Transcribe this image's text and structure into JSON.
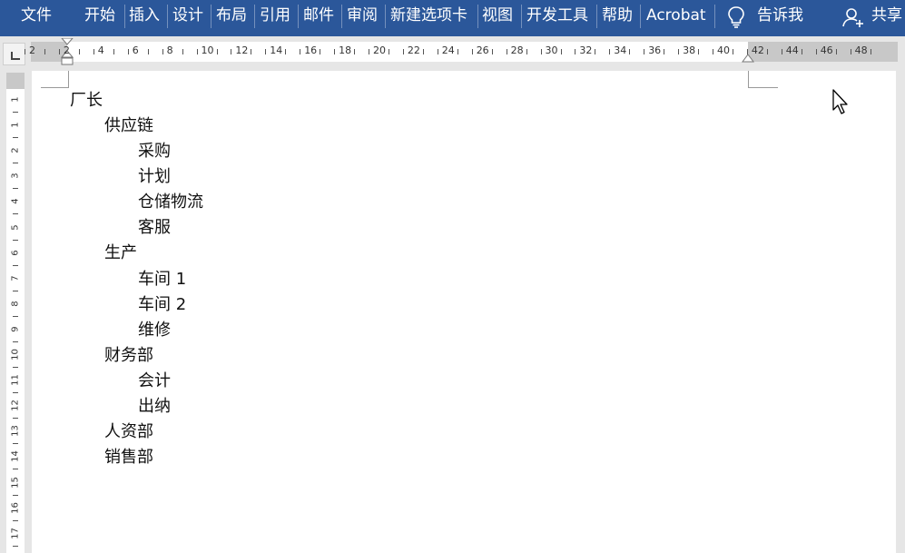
{
  "ribbon": {
    "tabs": [
      "文件",
      "开始",
      "插入",
      "设计",
      "布局",
      "引用",
      "邮件",
      "审阅",
      "新建选项卡",
      "视图",
      "开发工具",
      "帮助",
      "Acrobat"
    ],
    "tell_me": "告诉我",
    "share": "共享"
  },
  "ruler": {
    "h_labels": [
      "2",
      "2",
      "4",
      "6",
      "8",
      "10",
      "12",
      "14",
      "16",
      "18",
      "20",
      "22",
      "24",
      "26",
      "28",
      "30",
      "32",
      "34",
      "36",
      "38",
      "40",
      "42",
      "44",
      "46",
      "48"
    ],
    "v_labels": [
      "1",
      "1",
      "2",
      "3",
      "4",
      "5",
      "6",
      "7",
      "8",
      "9",
      "10",
      "11",
      "12",
      "13",
      "14",
      "15",
      "16",
      "17",
      "18"
    ]
  },
  "document": {
    "lines": [
      {
        "text": "厂长",
        "level": 0
      },
      {
        "text": "供应链",
        "level": 1
      },
      {
        "text": "采购",
        "level": 2
      },
      {
        "text": "计划",
        "level": 2
      },
      {
        "text": "仓储物流",
        "level": 2
      },
      {
        "text": "客服",
        "level": 2
      },
      {
        "text": "生产",
        "level": 1
      },
      {
        "text": "车间 1",
        "level": 2
      },
      {
        "text": "车间 2",
        "level": 2
      },
      {
        "text": "维修",
        "level": 2
      },
      {
        "text": "财务部",
        "level": 1
      },
      {
        "text": "会计",
        "level": 2
      },
      {
        "text": "出纳",
        "level": 2
      },
      {
        "text": "人资部",
        "level": 1
      },
      {
        "text": "销售部",
        "level": 1
      }
    ]
  },
  "colors": {
    "ribbon": "#2b579a",
    "workspace": "#e6e6e6"
  }
}
